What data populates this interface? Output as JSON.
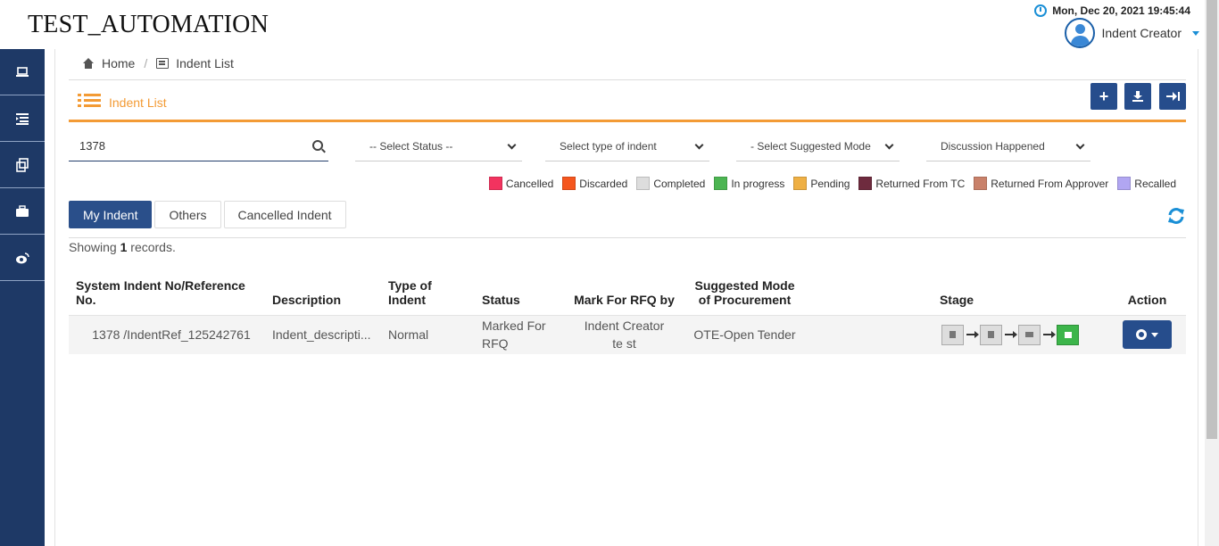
{
  "app": {
    "title": "TEST_AUTOMATION"
  },
  "header": {
    "datetime": "Mon, Dec 20, 2021 19:45:44",
    "user_name": "Indent Creator"
  },
  "sidebar": {
    "items": [
      {
        "name": "laptop-icon"
      },
      {
        "name": "list-icon"
      },
      {
        "name": "copy-icon"
      },
      {
        "name": "briefcase-icon"
      },
      {
        "name": "weibo-icon"
      }
    ]
  },
  "breadcrumb": {
    "home": "Home",
    "current": "Indent List"
  },
  "page": {
    "title": "Indent List"
  },
  "toolbar": {
    "add": "+",
    "download": "download-icon",
    "exit": "exit-icon"
  },
  "filters": {
    "search_value": "1378",
    "status": "-- Select Status --",
    "type": "Select type of indent",
    "mode": "- Select Suggested Mode of Procurement -",
    "discussion": "Discussion Happened"
  },
  "legend": [
    {
      "label": "Cancelled",
      "color": "#f2335f"
    },
    {
      "label": "Discarded",
      "color": "#f5561e"
    },
    {
      "label": "Completed",
      "color": "#dddddd"
    },
    {
      "label": "In progress",
      "color": "#4cb552"
    },
    {
      "label": "Pending",
      "color": "#efb044"
    },
    {
      "label": "Returned From TC",
      "color": "#6e2b3e"
    },
    {
      "label": "Returned From Approver",
      "color": "#c9816a"
    },
    {
      "label": "Recalled",
      "color": "#b1a6f2"
    }
  ],
  "tabs": [
    "My Indent",
    "Others",
    "Cancelled Indent"
  ],
  "records": {
    "prefix": "Showing ",
    "count": "1",
    "suffix": " records."
  },
  "table": {
    "headers": [
      "System Indent No/Reference No.",
      "Description",
      "Type of Indent",
      "Status",
      "Mark For RFQ by",
      "Suggested Mode of Procurement",
      "Stage",
      "Action"
    ],
    "rows": [
      {
        "ref": "1378 /IndentRef_125242761",
        "description": "Indent_descripti...",
        "type": "Normal",
        "status": "Marked For RFQ",
        "rfq_by": "Indent Creator te st",
        "mode": "OTE-Open Tender"
      }
    ]
  }
}
